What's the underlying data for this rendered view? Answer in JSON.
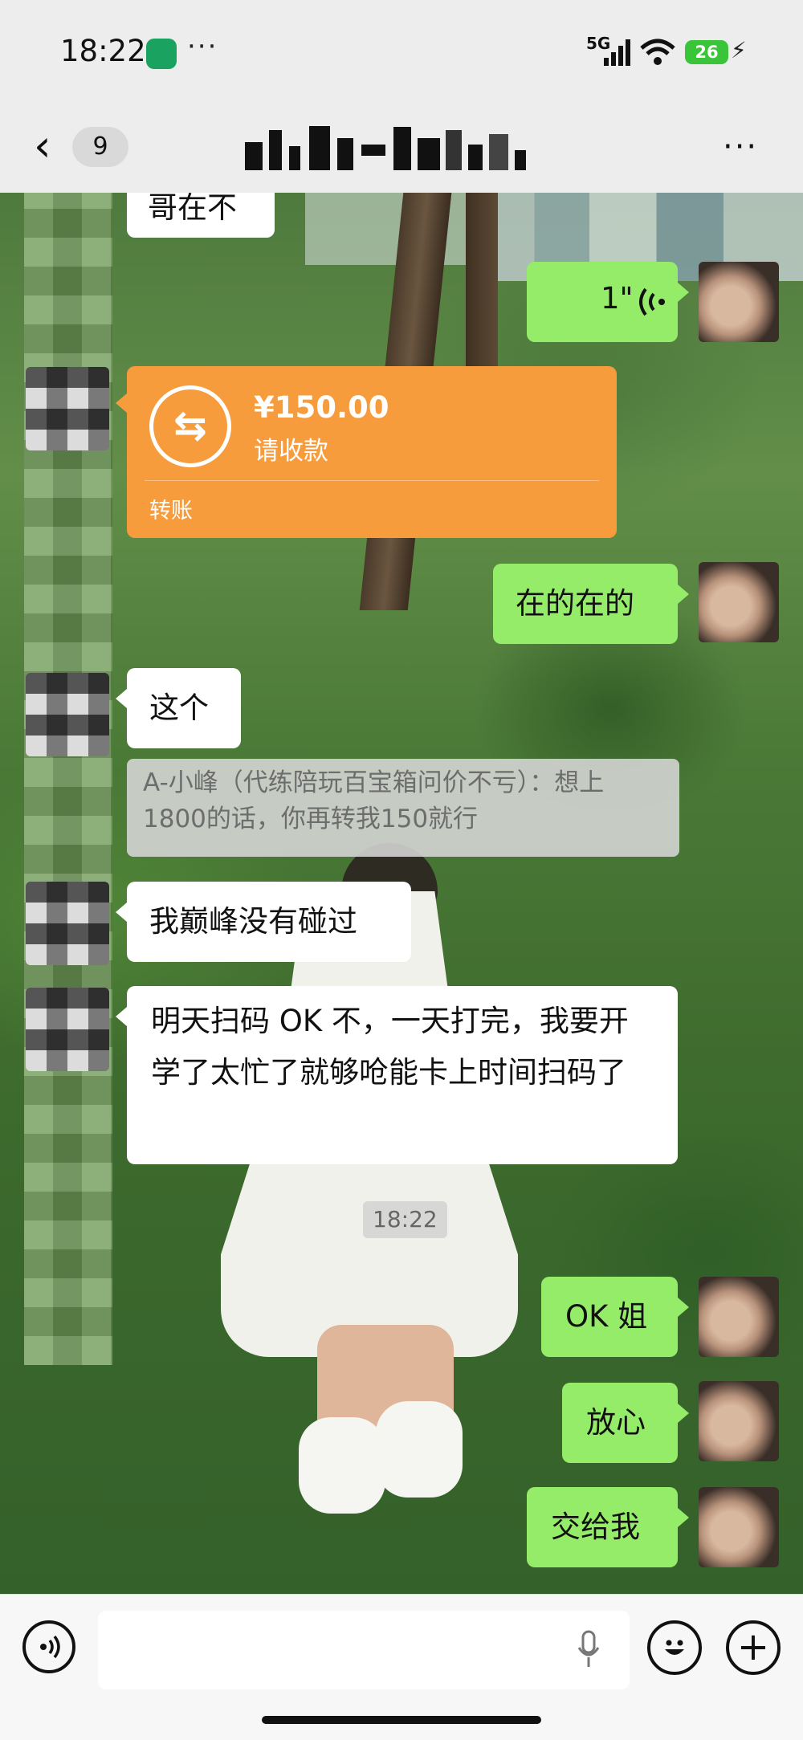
{
  "status_bar": {
    "time": "18:22",
    "dots": "···",
    "network": "5G",
    "battery": "26"
  },
  "header": {
    "unread_count": "9",
    "more": "···"
  },
  "transfer": {
    "amount": "¥150.00",
    "subtitle": "请收款",
    "footer": "转账",
    "icon": "⇆"
  },
  "messages": {
    "top_partial": "哥在不",
    "voice_duration": "1\"",
    "reply_1": "在的在的",
    "this": "这个",
    "quote": "A-小峰（代练陪玩百宝箱问价不亏）：想上1800的话，你再转我150就行",
    "peak": "我巅峰没有碰过",
    "long": "明天扫码 OK 不，一天打完，我要开学了太忙了就够呛能卡上时间扫码了",
    "timestamp": "18:22",
    "ok": "OK 姐",
    "relax": "放心",
    "leave_it": "交给我"
  }
}
